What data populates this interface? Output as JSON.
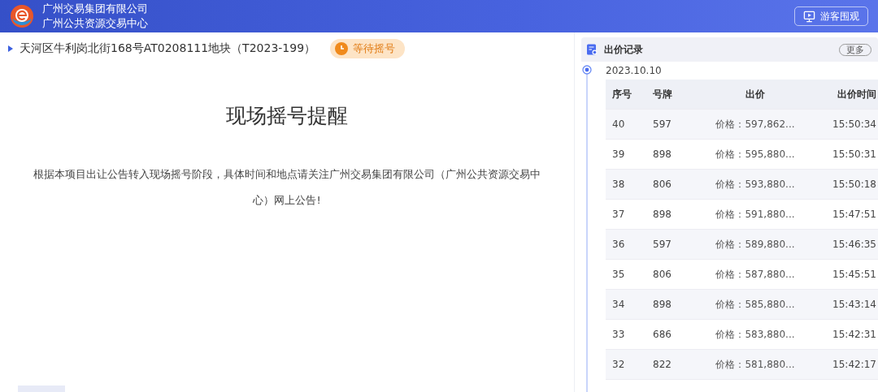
{
  "header": {
    "org_name": "广州交易集团有限公司",
    "org_subname": "广州公共资源交易中心",
    "guest_button": "游客围观"
  },
  "lot": {
    "title": "天河区牛利岗北街168号AT0208111地块（T2023-199）",
    "status_badge": "等待摇号"
  },
  "notice": {
    "heading": "现场摇号提醒",
    "body": "根据本项目出让公告转入现场摇号阶段，具体时间和地点请关注广州交易集团有限公司（广州公共资源交易中心）网上公告!"
  },
  "bid_panel": {
    "title": "出价记录",
    "more_button": "更多",
    "date": "2023.10.10",
    "columns": [
      "序号",
      "号牌",
      "出价",
      "出价时间"
    ],
    "rows": [
      {
        "no": "40",
        "plate": "597",
        "price": "价格：597,862...",
        "time": "15:50:34"
      },
      {
        "no": "39",
        "plate": "898",
        "price": "价格：595,880...",
        "time": "15:50:31"
      },
      {
        "no": "38",
        "plate": "806",
        "price": "价格：593,880...",
        "time": "15:50:18"
      },
      {
        "no": "37",
        "plate": "898",
        "price": "价格：591,880...",
        "time": "15:47:51"
      },
      {
        "no": "36",
        "plate": "597",
        "price": "价格：589,880...",
        "time": "15:46:35"
      },
      {
        "no": "35",
        "plate": "806",
        "price": "价格：587,880...",
        "time": "15:45:51"
      },
      {
        "no": "34",
        "plate": "898",
        "price": "价格：585,880...",
        "time": "15:43:14"
      },
      {
        "no": "33",
        "plate": "686",
        "price": "价格：583,880...",
        "time": "15:42:31"
      },
      {
        "no": "32",
        "plate": "822",
        "price": "价格：581,880...",
        "time": "15:42:17"
      }
    ]
  }
}
